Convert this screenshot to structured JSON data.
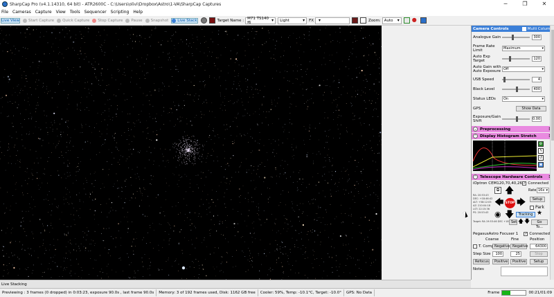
{
  "window": {
    "title": "SharpCap Pro (v4.1.14310, 64 bit) - ATR2600C - C:\\Users\\olivi\\Dropbox\\Astro\\1-VA\\SharpCap Captures",
    "controls": [
      "─",
      "❐",
      "✕"
    ]
  },
  "menu": [
    "File",
    "Cameras",
    "Capture",
    "View",
    "Tools",
    "Sequencer",
    "Scripting",
    "Help"
  ],
  "toolbar": {
    "live_view": "Live View",
    "start_capture": "Start Capture",
    "quick_capture": "Quick Capture",
    "stop_capture": "Stop Capture",
    "pause": "Pause",
    "snapshot": "Snapshot",
    "live_stack": "Live Stack",
    "target_name_label": "Target Name :",
    "target_name_value": "M71 TS140 f6",
    "frame_type_value": "Light",
    "fx_label": "FX",
    "fx_value": "",
    "zoom_label": "Zoom:",
    "zoom_value": "Auto"
  },
  "camera_controls": {
    "header": "Camera Controls",
    "multi_column": "Multi Column",
    "analogue_gain_label": "Analogue Gain",
    "analogue_gain_value": "300",
    "frame_rate_label": "Frame Rate Limit",
    "frame_rate_value": "Maximum",
    "auto_exp_label": "Auto Exp Target",
    "auto_exp_value": "120",
    "auto_gain_label": "Auto Gain with Auto Exposure",
    "auto_gain_value": "Off",
    "usb_speed_label": "USB Speed",
    "usb_speed_value": "4",
    "black_level_label": "Black Level",
    "black_level_value": "400",
    "status_leds_label": "Status LEDs",
    "status_leds_value": "On",
    "gps_label": "GPS",
    "show_data": "Show Data",
    "exposure_shift_label": "Exposure/Gain Shift",
    "exposure_shift_value": "0.00"
  },
  "preprocessing": {
    "header": "Preprocessing"
  },
  "histogram": {
    "header": "Display Histogram Stretch"
  },
  "telescope": {
    "header": "Telescope Hardware Controls",
    "mount_name": "iOptron CEM120,70,40,26",
    "connected_label": "Connected",
    "rate_label": "Rate:",
    "rate_value": "16x",
    "setup": "Setup",
    "park": "Park",
    "stop": "STOP",
    "tracking": "Tracking",
    "set": "Set",
    "goto": "Go To...",
    "info_rows": [
      "RA: 20:53:43",
      "DEC: +18:46:42",
      "ALT: +58:12:05",
      "AZ: 210:04:18",
      "LST: 22:15:36",
      "PS: 20:53:43"
    ],
    "target_line": "Target: RA 19:53:46 DEC +18:46:42"
  },
  "focuser": {
    "name": "PegasusAstro Focuser 1",
    "connected_label": "Connected",
    "coarse": "Coarse",
    "fine": "Fine",
    "position": "Position",
    "t_comp": "T. Comp",
    "negative1": "Negative",
    "negative2": "Negative",
    "position_value": "64300",
    "step_size_label": "Step Size",
    "step1": "100",
    "step2": "25",
    "stop": "Stop",
    "refocus": "Refocus",
    "positive1": "Positive",
    "positive2": "Positive",
    "setup": "Setup",
    "notes": "Notes"
  },
  "live_strip": {
    "label": "Live Stacking"
  },
  "status": {
    "preview": "Previewing : 3 frames (0 dropped) in 0:03:23, exposure 90.0s , last frame 90.0s",
    "memory": "Memory: 3 of 192 frames used, Disk: 1162 GB free",
    "cooler": "Cooler: 59%, Temp: -10.1°C, Target: -10.0°",
    "gps": "GPS: No Data",
    "frame_label": "Frame",
    "frame_progress": 0.35,
    "elapsed": "00:21/01:09"
  }
}
